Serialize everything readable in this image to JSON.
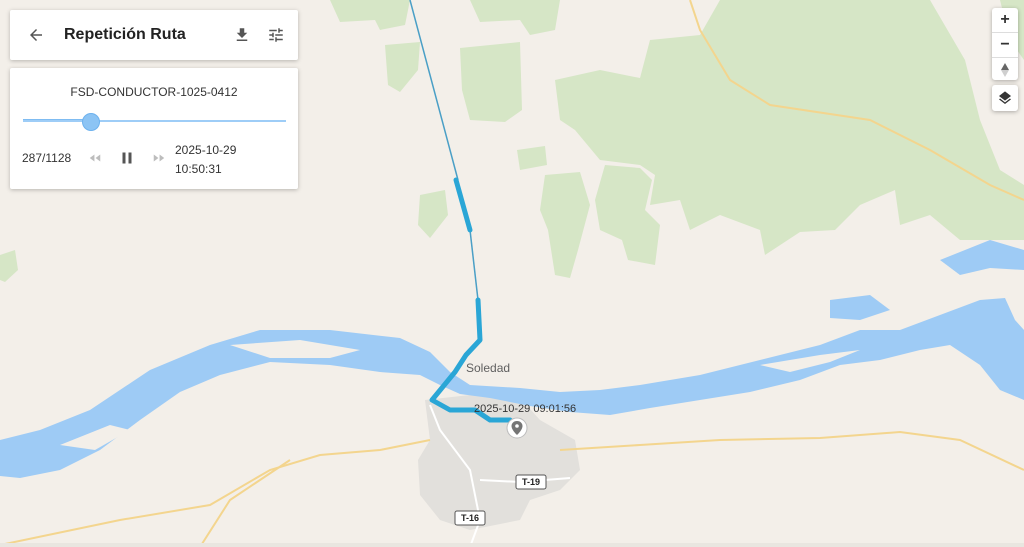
{
  "header": {
    "title": "Repetición Ruta",
    "back_icon": "arrow-left-icon",
    "download_icon": "download-icon",
    "settings_icon": "tune-sliders-icon"
  },
  "player": {
    "device_name": "FSD-CONDUCTOR-1025-0412",
    "counter": "287/1128",
    "progress_fraction": 0.254,
    "date": "2025-10-29",
    "time": "10:50:31",
    "controls": [
      "rewind-icon",
      "pause-icon",
      "fast-forward-icon"
    ]
  },
  "map": {
    "town_label": "Soledad",
    "start_timestamp": "2025-10-29 09:01:56",
    "road_shields": [
      "T-19",
      "T-16"
    ],
    "route_color": "#2aa6d6",
    "water_color": "#9ecbf5",
    "vegetation_color": "#d6e6c6"
  },
  "zoom": {
    "plus": "+",
    "minus": "−",
    "compass_icon": "compass-icon",
    "layers_icon": "layers-icon"
  }
}
